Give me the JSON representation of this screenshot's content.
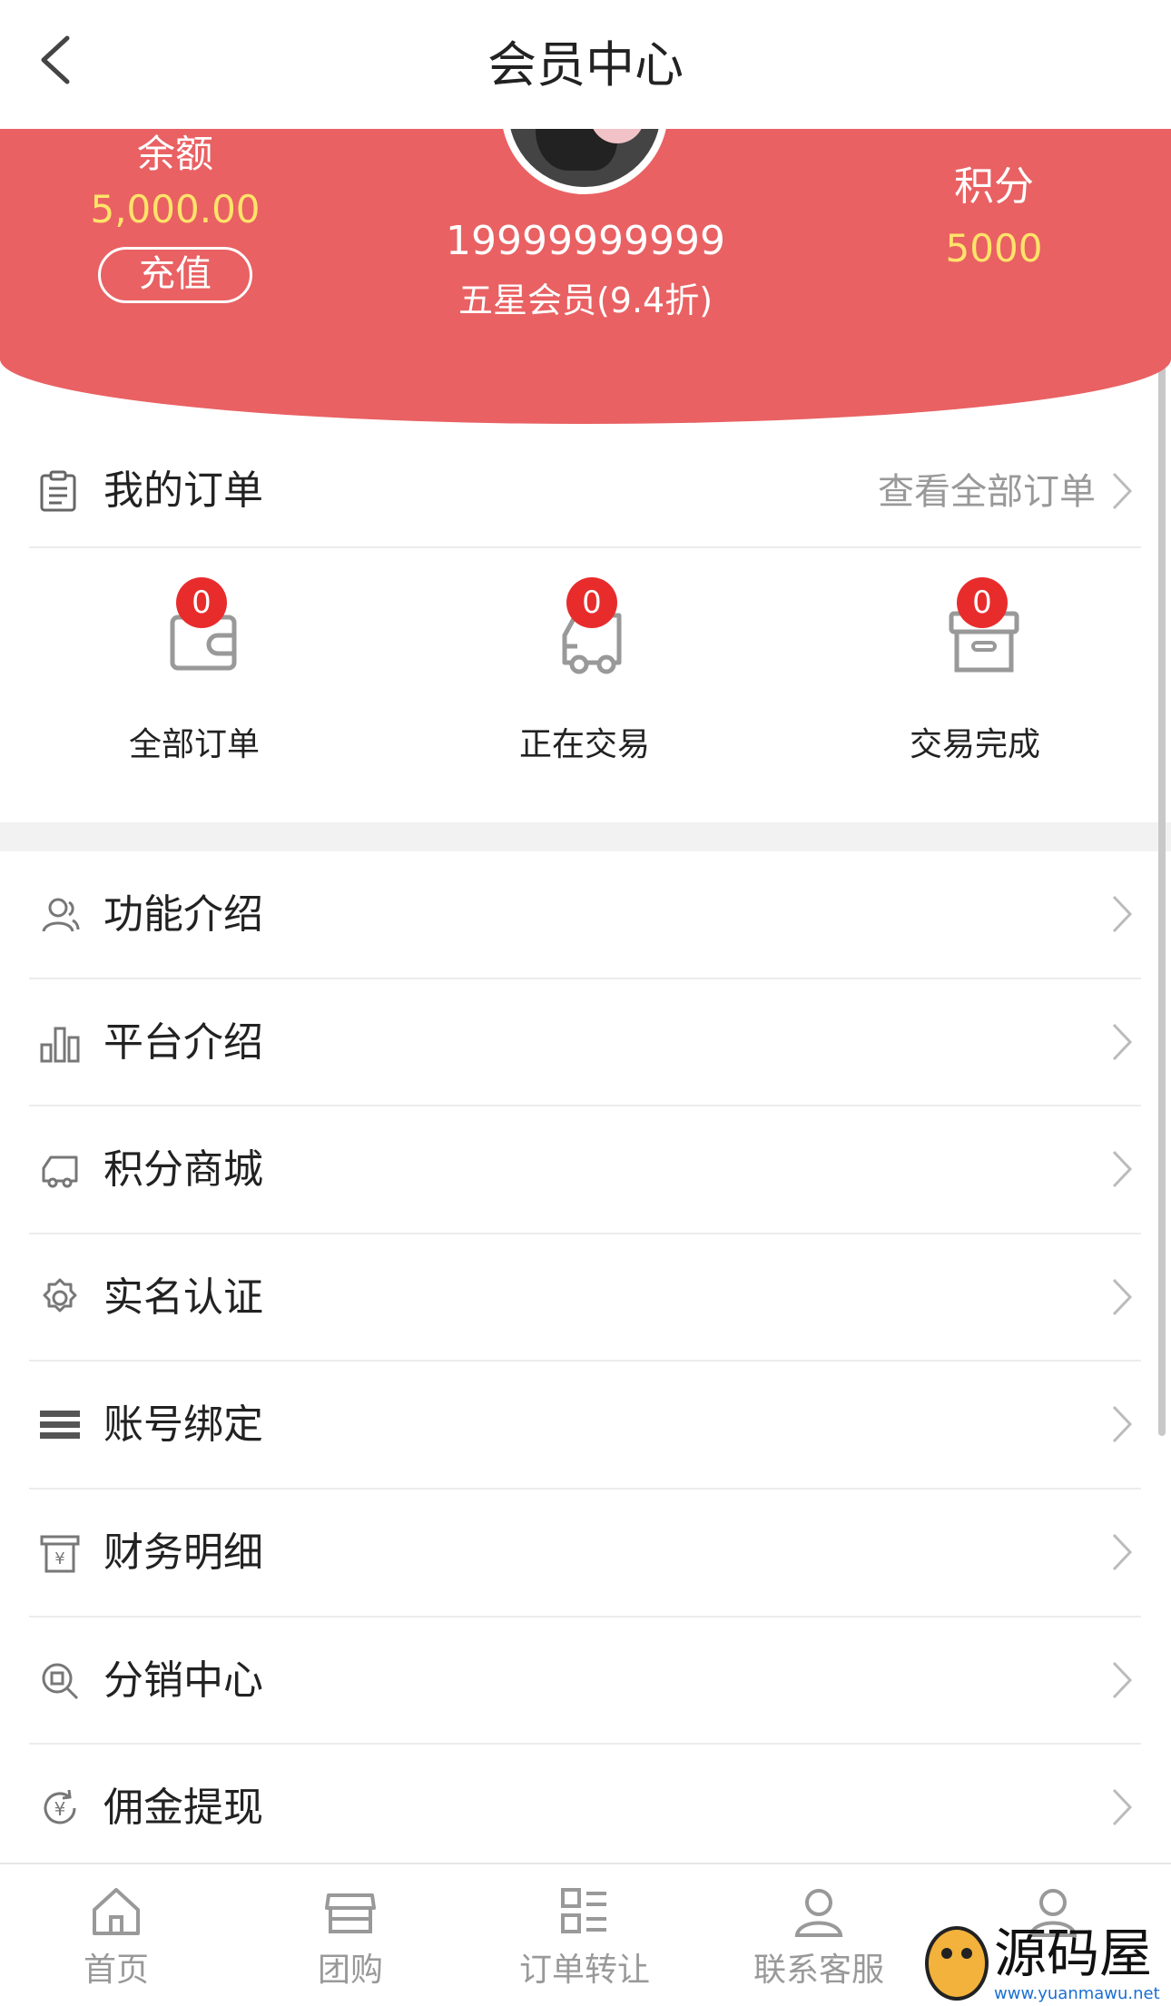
{
  "header": {
    "title": "会员中心"
  },
  "profile": {
    "balance_label": "余额",
    "balance_value": "5,000.00",
    "recharge_label": "充值",
    "phone": "19999999999",
    "level": "五星会员(9.4折)",
    "points_label": "积分",
    "points_value": "5000"
  },
  "orders": {
    "title": "我的订单",
    "view_all": "查看全部订单",
    "items": [
      {
        "label": "全部订单",
        "count": "0",
        "icon": "wallet-icon"
      },
      {
        "label": "正在交易",
        "count": "0",
        "icon": "truck-icon"
      },
      {
        "label": "交易完成",
        "count": "0",
        "icon": "box-icon"
      }
    ]
  },
  "menu": [
    {
      "label": "功能介绍",
      "icon": "users-icon"
    },
    {
      "label": "平台介绍",
      "icon": "bar-chart-icon"
    },
    {
      "label": "积分商城",
      "icon": "truck-icon"
    },
    {
      "label": "实名认证",
      "icon": "gear-icon"
    },
    {
      "label": "账号绑定",
      "icon": "menu-lines-icon"
    },
    {
      "label": "财务明细",
      "icon": "finance-icon"
    },
    {
      "label": "分销中心",
      "icon": "search-doc-icon"
    },
    {
      "label": "佣金提现",
      "icon": "yen-refresh-icon"
    }
  ],
  "tabbar": [
    {
      "label": "首页",
      "icon": "home-icon"
    },
    {
      "label": "团购",
      "icon": "store-icon"
    },
    {
      "label": "订单转让",
      "icon": "list-icon"
    },
    {
      "label": "联系客服",
      "icon": "user-icon"
    },
    {
      "label": "",
      "icon": "user-icon"
    }
  ],
  "watermark": {
    "text": "源码屋",
    "url": "www.yuanmawu.net"
  },
  "colors": {
    "banner": "#e96163",
    "gold": "#ffe36a",
    "badge": "#e82c2c"
  }
}
